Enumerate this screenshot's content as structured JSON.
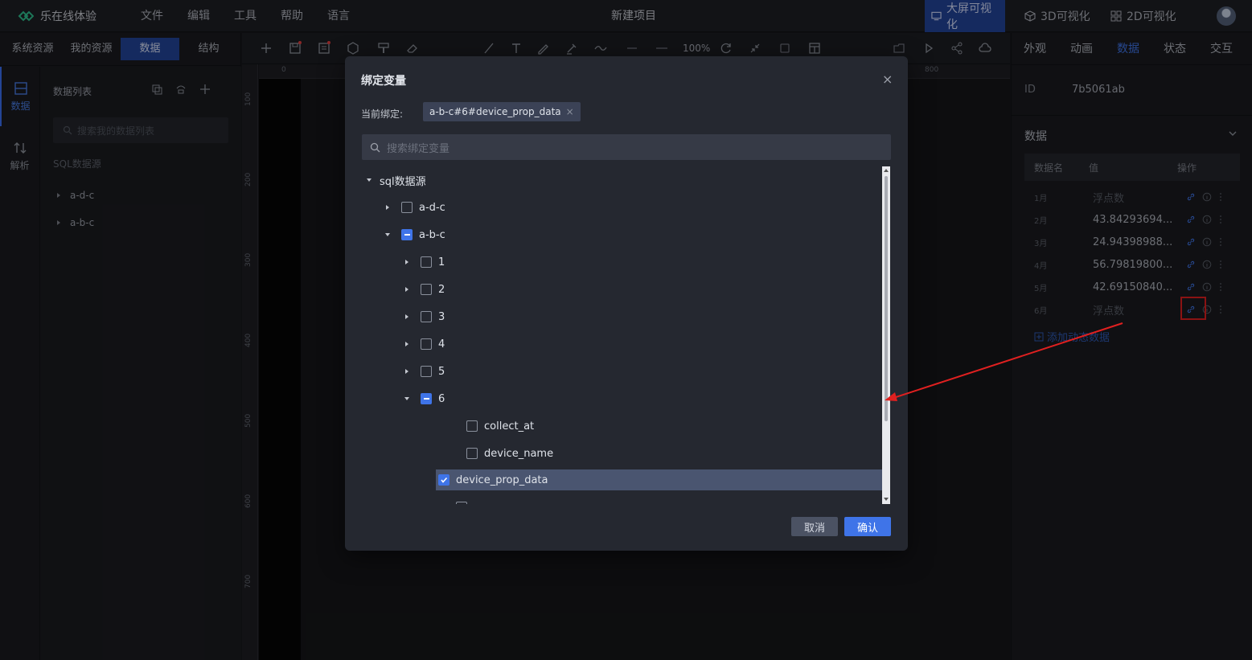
{
  "topbar": {
    "app_name": "乐在线体验",
    "menu": [
      "文件",
      "编辑",
      "工具",
      "帮助",
      "语言"
    ],
    "project_title": "新建项目",
    "view_tabs": [
      "大屏可视化",
      "3D可视化",
      "2D可视化"
    ]
  },
  "left_panel": {
    "tabs": [
      "系统资源",
      "我的资源",
      "数据",
      "结构"
    ],
    "rail": [
      "数据",
      "解析"
    ],
    "list_title": "数据列表",
    "search_placeholder": "搜索我的数据列表",
    "sql_label": "SQL数据源",
    "nodes": [
      "a-d-c",
      "a-b-c"
    ]
  },
  "toolbar": {
    "zoom": "100%"
  },
  "rulers": {
    "h": [
      "0",
      "800"
    ],
    "v": [
      "100",
      "200",
      "300",
      "400",
      "500",
      "600",
      "700"
    ]
  },
  "right_panel": {
    "tabs": [
      "外观",
      "动画",
      "数据",
      "状态",
      "交互"
    ],
    "id_label": "ID",
    "id_value": "7b5061ab",
    "section_title": "数据",
    "table_headers": [
      "数据名",
      "值",
      "操作"
    ],
    "rows": [
      {
        "name": "1月",
        "value": "浮点数"
      },
      {
        "name": "2月",
        "value": "43.84293694..."
      },
      {
        "name": "3月",
        "value": "24.94398988..."
      },
      {
        "name": "4月",
        "value": "56.79819800..."
      },
      {
        "name": "5月",
        "value": "42.69150840..."
      },
      {
        "name": "6月",
        "value": "浮点数"
      }
    ],
    "add_label": "添加动态数据"
  },
  "modal": {
    "title": "绑定变量",
    "current_label": "当前绑定:",
    "current_value": "a-b-c#6#device_prop_data",
    "search_placeholder": "搜索绑定变量",
    "tree": {
      "root": "sql数据源",
      "source1": "a-d-c",
      "source2": "a-b-c",
      "groups": [
        "1",
        "2",
        "3",
        "4",
        "5",
        "6"
      ],
      "fields": [
        "collect_at",
        "device_name",
        "device_prop_data"
      ]
    },
    "cancel": "取消",
    "confirm": "确认"
  },
  "colors": {
    "accent": "#3f74e8",
    "active_tab_bg": "#23449a",
    "annotation": "#e02020"
  }
}
